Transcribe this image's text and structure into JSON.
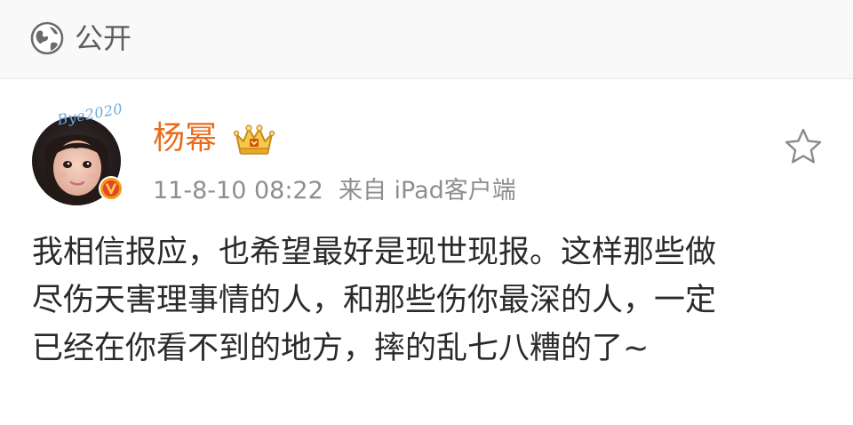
{
  "visibility": {
    "icon": "globe-icon",
    "label": "公开"
  },
  "post": {
    "author": {
      "name": "杨幂",
      "avatar_decoration_text": "Bye2020",
      "verified_badge": "V",
      "member_icon": "crown-icon"
    },
    "meta": {
      "time": "11-8-10 08:22",
      "source": "来自 iPad客户端"
    },
    "favorite_icon": "star-icon",
    "content_lines": [
      "我相信报应，也希望最好是现世现报。这样那些做",
      "尽伤天害理事情的人，和那些伤你最深的人，一定",
      "已经在你看不到的地方，摔的乱七八糟的了~"
    ]
  },
  "colors": {
    "author_name": "#e96c1d",
    "meta_text": "#8e8e8e",
    "body_text": "#2a2a2a",
    "verified_badge": "#f39c12",
    "header_bg": "#f9f9f9"
  }
}
